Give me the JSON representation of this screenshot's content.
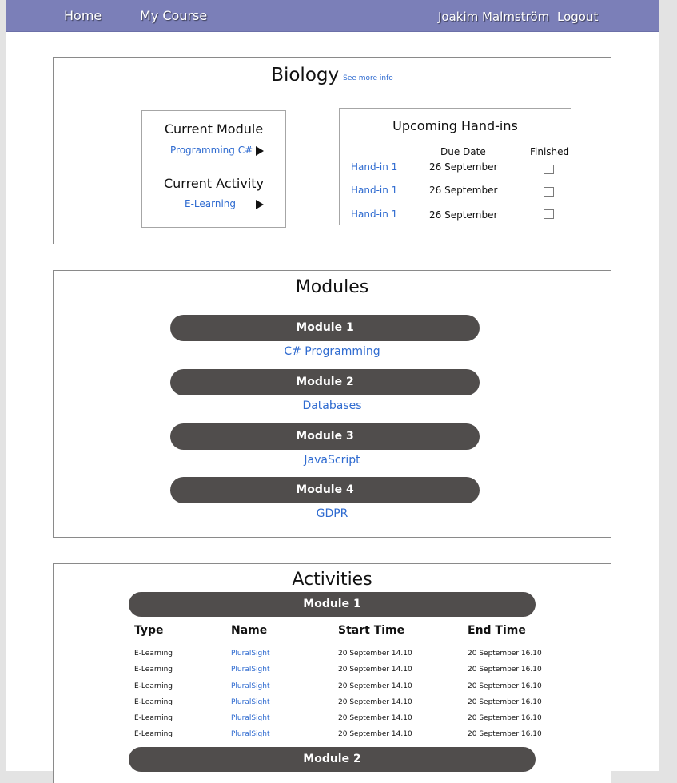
{
  "nav": {
    "home": "Home",
    "my_course": "My Course",
    "user_name": "Joakim Malmström",
    "logout": "Logout"
  },
  "course": {
    "title": "Biology",
    "see_more": "See more info",
    "current_module_heading": "Current Module",
    "current_module_value": "Programming C#",
    "current_activity_heading": "Current Activity",
    "current_activity_value": "E-Learning"
  },
  "handins": {
    "heading": "Upcoming Hand-ins",
    "col_due": "Due Date",
    "col_finished": "Finished",
    "rows": [
      {
        "name": "Hand-in 1",
        "due": "26 September",
        "finished": false
      },
      {
        "name": "Hand-in 1",
        "due": "26 September",
        "finished": false
      },
      {
        "name": "Hand-in 1",
        "due": "26 September",
        "finished": false
      }
    ]
  },
  "modules": {
    "heading": "Modules",
    "items": [
      {
        "label": "Module 1",
        "name": "C# Programming"
      },
      {
        "label": "Module 2",
        "name": "Databases"
      },
      {
        "label": "Module 3",
        "name": "JavaScript"
      },
      {
        "label": "Module 4",
        "name": "GDPR"
      }
    ]
  },
  "activities": {
    "heading": "Activities",
    "group1": "Module 1",
    "group2": "Module 2",
    "columns": [
      "Type",
      "Name",
      "Start Time",
      "End Time"
    ],
    "rows": [
      [
        "E-Learning",
        "PluralSight",
        "20 September 14.10",
        "20 September 16.10"
      ],
      [
        "E-Learning",
        "PluralSight",
        "20 September 14.10",
        "20 September 16.10"
      ],
      [
        "E-Learning",
        "PluralSight",
        "20 September 14.10",
        "20 September 16.10"
      ],
      [
        "E-Learning",
        "PluralSight",
        "20 September 14.10",
        "20 September 16.10"
      ],
      [
        "E-Learning",
        "PluralSight",
        "20 September 14.10",
        "20 September 16.10"
      ],
      [
        "E-Learning",
        "PluralSight",
        "20 September 14.10",
        "20 September 16.10"
      ]
    ]
  },
  "colors": {
    "navbar": "#7b7fb8",
    "pill": "#504d4c",
    "link": "#2f6bd0"
  }
}
